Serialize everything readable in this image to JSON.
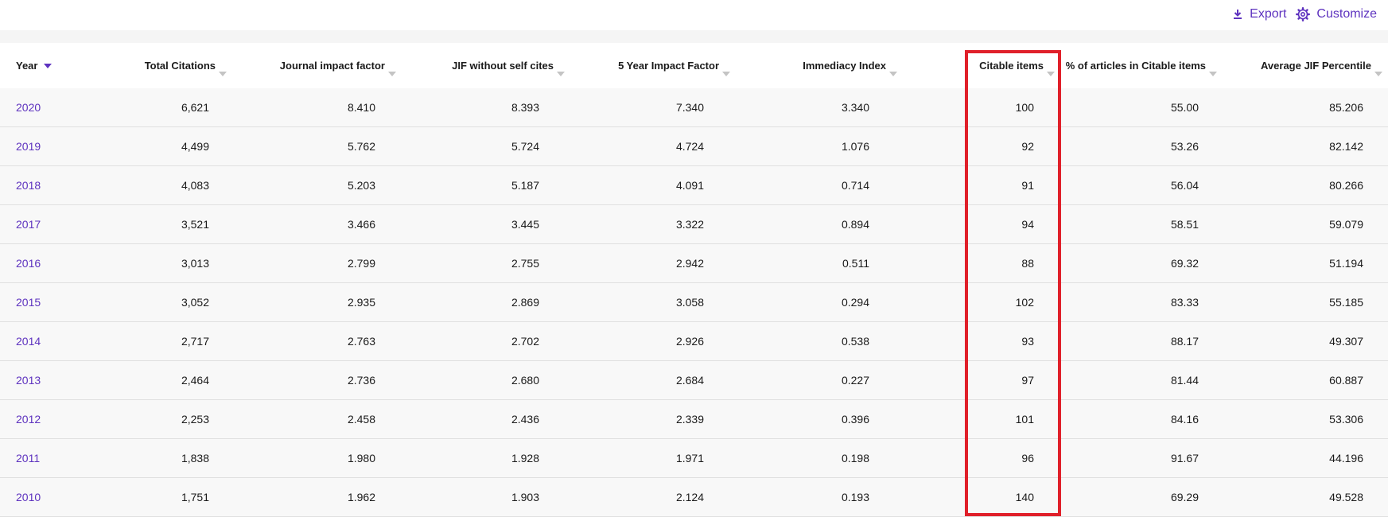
{
  "toolbar": {
    "export_label": "Export",
    "customize_label": "Customize"
  },
  "table": {
    "headers": [
      "Year",
      "Total Citations",
      "Journal impact factor",
      "JIF without self cites",
      "5 Year Impact Factor",
      "Immediacy Index",
      "Citable items",
      "% of articles in Citable items",
      "Average JIF Percentile"
    ],
    "sorted_column": "Year",
    "highlighted_column": "Citable items",
    "rows": [
      [
        "2020",
        "6,621",
        "8.410",
        "8.393",
        "7.340",
        "3.340",
        "100",
        "55.00",
        "85.206"
      ],
      [
        "2019",
        "4,499",
        "5.762",
        "5.724",
        "4.724",
        "1.076",
        "92",
        "53.26",
        "82.142"
      ],
      [
        "2018",
        "4,083",
        "5.203",
        "5.187",
        "4.091",
        "0.714",
        "91",
        "56.04",
        "80.266"
      ],
      [
        "2017",
        "3,521",
        "3.466",
        "3.445",
        "3.322",
        "0.894",
        "94",
        "58.51",
        "59.079"
      ],
      [
        "2016",
        "3,013",
        "2.799",
        "2.755",
        "2.942",
        "0.511",
        "88",
        "69.32",
        "51.194"
      ],
      [
        "2015",
        "3,052",
        "2.935",
        "2.869",
        "3.058",
        "0.294",
        "102",
        "83.33",
        "55.185"
      ],
      [
        "2014",
        "2,717",
        "2.763",
        "2.702",
        "2.926",
        "0.538",
        "93",
        "88.17",
        "49.307"
      ],
      [
        "2013",
        "2,464",
        "2.736",
        "2.680",
        "2.684",
        "0.227",
        "97",
        "81.44",
        "60.887"
      ],
      [
        "2012",
        "2,253",
        "2.458",
        "2.436",
        "2.339",
        "0.396",
        "101",
        "84.16",
        "53.306"
      ],
      [
        "2011",
        "1,838",
        "1.980",
        "1.928",
        "1.971",
        "0.198",
        "96",
        "91.67",
        "44.196"
      ],
      [
        "2010",
        "1,751",
        "1.962",
        "1.903",
        "2.124",
        "0.193",
        "140",
        "69.29",
        "49.528"
      ]
    ]
  },
  "colors": {
    "accent": "#5e33bf",
    "highlight_border": "#e0202a"
  },
  "icons": {
    "export": "download-icon",
    "customize": "gear-icon"
  }
}
